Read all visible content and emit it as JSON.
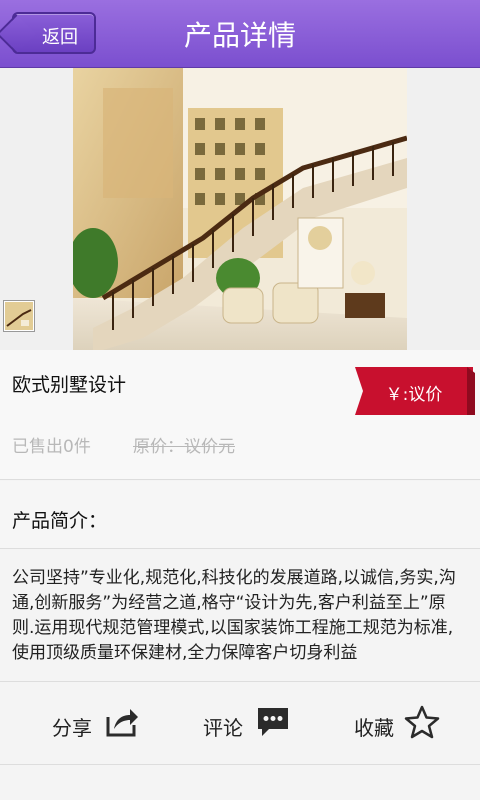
{
  "header": {
    "back_label": "返回",
    "title": "产品详情"
  },
  "product": {
    "name": "欧式别墅设计",
    "price_label": "￥:议价",
    "sold_text": "已售出0件",
    "original_price_text": "原价：议价元"
  },
  "intro": {
    "heading": "产品简介：",
    "body": "公司坚持”专业化,规范化,科技化的发展道路,以诚信,务实,沟通,创新服务”为经营之道,格守“设计为先,客户利益至上”原则.运用现代规范管理模式,以国家装饰工程施工规范为标准,使用顶级质量环保建材,全力保障客户切身利益"
  },
  "actions": {
    "share_label": "分享",
    "comment_label": "评论",
    "favorite_label": "收藏"
  },
  "colors": {
    "header_purple": "#7b4fcf",
    "price_red": "#c8102e"
  },
  "icons": [
    "back-arrow-icon",
    "share-icon",
    "comment-icon",
    "star-icon"
  ]
}
